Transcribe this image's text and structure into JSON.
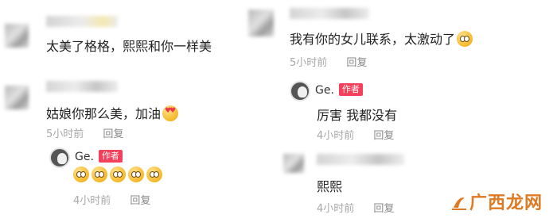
{
  "left_column": {
    "comment1": {
      "text": "太美了格格，熙熙和你一样美"
    },
    "comment2": {
      "text": "姑娘你那么美，加油",
      "time": "5小时前",
      "reply": "回复"
    },
    "reply1": {
      "username": "Ge.",
      "author_tag": "作者",
      "emoji_icons": [
        "tear-eyes-emoji",
        "tear-eyes-emoji",
        "tear-eyes-emoji",
        "tear-eyes-emoji",
        "tear-eyes-emoji"
      ],
      "time": "4小时前",
      "reply": "回复"
    }
  },
  "right_column": {
    "comment1": {
      "text": "我有你的女儿联系，太激动了",
      "time": "5小时前",
      "reply": "回复"
    },
    "reply1": {
      "username": "Ge.",
      "author_tag": "作者",
      "text": "厉害 我都没有",
      "time": "4小时前",
      "reply": "回复"
    },
    "comment2": {
      "text": "熙熙",
      "time": "4小时前",
      "reply": "回复"
    }
  },
  "watermark": {
    "text": "广西龙网"
  },
  "colors": {
    "author_tag": "#f4405b",
    "meta": "#a8a8a8",
    "watermark": "#e07a22"
  }
}
